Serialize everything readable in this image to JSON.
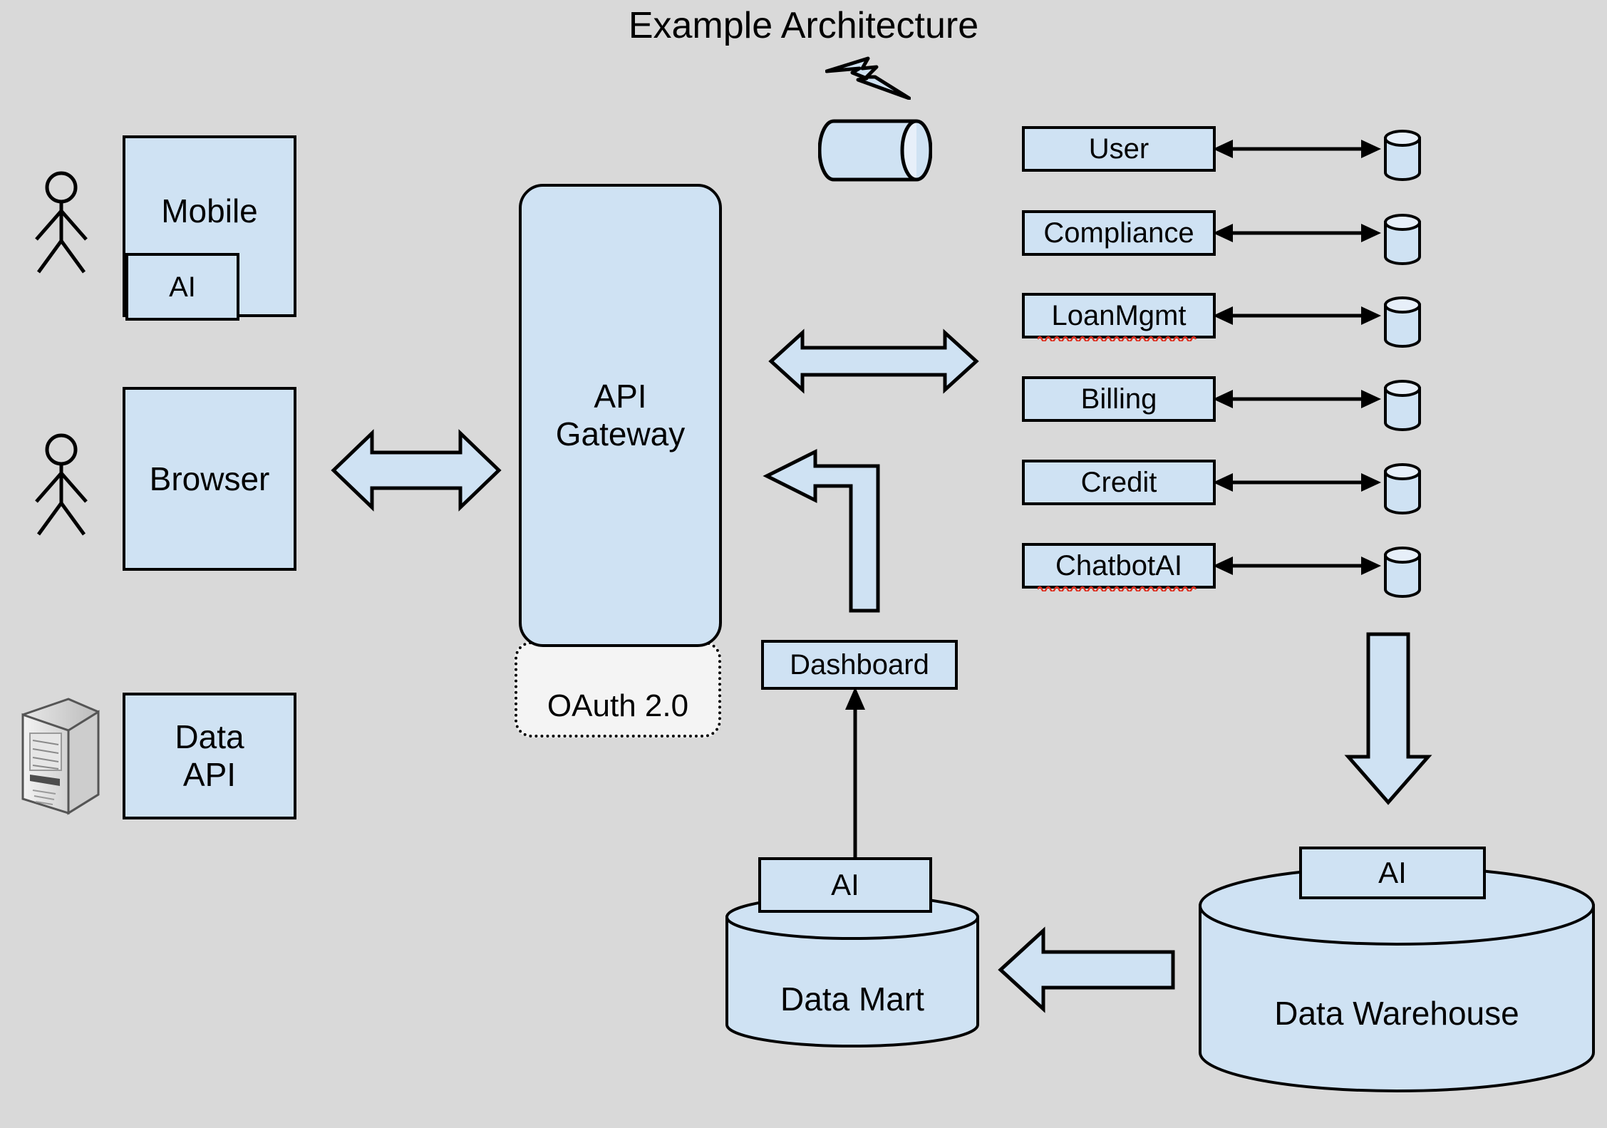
{
  "diagram": {
    "title": "Example Architecture",
    "background_color": "#d9d9d9",
    "shape_fill_color": "#cfe2f3",
    "shape_stroke_color": "#000000",
    "oauth_fill_color": "#f4f4f4",
    "spellcheck_underline_color": "#e03020"
  },
  "clients": {
    "mobile": {
      "label": "Mobile",
      "nested_label": "AI",
      "actor_icon": "stick-figure-actor-icon"
    },
    "browser": {
      "label": "Browser",
      "actor_icon": "stick-figure-actor-icon"
    },
    "data_api": {
      "label": "Data\nAPI",
      "line1": "Data",
      "line2": "API",
      "server_icon": "server-tower-icon"
    }
  },
  "gateway": {
    "line1": "API",
    "line2": "Gateway",
    "auth_label": "OAuth 2.0"
  },
  "top_decoration": {
    "bolt_icon": "lightning-bolt-icon",
    "queue_icon": "horizontal-cylinder-icon"
  },
  "services": [
    {
      "label": "User",
      "misspelled": false,
      "db_icon": "database-cylinder-icon"
    },
    {
      "label": "Compliance",
      "misspelled": false,
      "db_icon": "database-cylinder-icon"
    },
    {
      "label": "LoanMgmt",
      "misspelled": true,
      "db_icon": "database-cylinder-icon"
    },
    {
      "label": "Billing",
      "misspelled": false,
      "db_icon": "database-cylinder-icon"
    },
    {
      "label": "Credit",
      "misspelled": false,
      "db_icon": "database-cylinder-icon"
    },
    {
      "label": "ChatbotAI",
      "misspelled": true,
      "db_icon": "database-cylinder-icon"
    }
  ],
  "analytics": {
    "dashboard": {
      "label": "Dashboard"
    },
    "data_mart": {
      "label": "Data Mart",
      "ai_label": "AI"
    },
    "data_warehouse": {
      "label": "Data Warehouse",
      "ai_label": "AI"
    }
  },
  "connectors": {
    "browser_to_gateway": "double-headed-block-arrow-icon",
    "gateway_to_services": "double-headed-block-arrow-icon",
    "dashboard_to_gateway": "bent-left-block-arrow-icon",
    "service_to_db": "double-headed-line-arrow-icon",
    "services_to_warehouse": "down-block-arrow-icon",
    "warehouse_to_mart": "left-block-arrow-icon",
    "mart_to_dashboard": "up-line-arrow-icon"
  }
}
